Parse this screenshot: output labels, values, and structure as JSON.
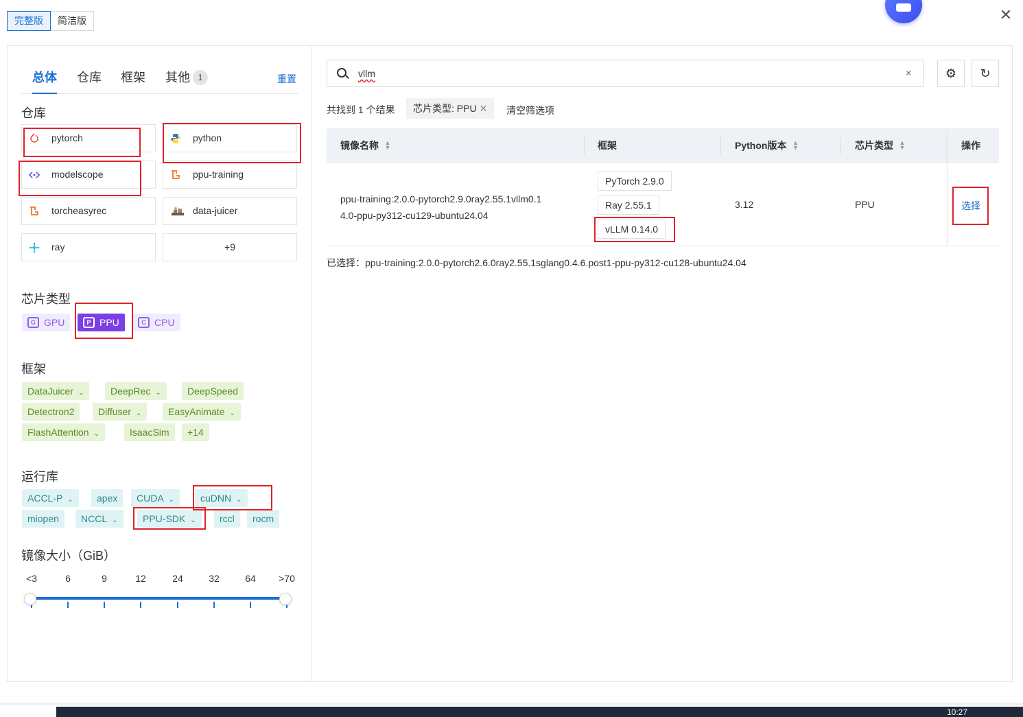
{
  "mode_switch": {
    "full": "完整版",
    "simple": "简洁版"
  },
  "tabs": [
    {
      "label": "总体"
    },
    {
      "label": "仓库"
    },
    {
      "label": "框架"
    },
    {
      "label": "其他",
      "badge": "1"
    }
  ],
  "reset_label": "重置",
  "sections": {
    "repo": "仓库",
    "chip": "芯片类型",
    "framework": "框架",
    "runtime": "运行库",
    "size": "镜像大小（GiB）"
  },
  "repos": [
    {
      "label": "pytorch",
      "icon": "pytorch-icon"
    },
    {
      "label": "python",
      "icon": "python-icon"
    },
    {
      "label": "modelscope",
      "icon": "modelscope-icon"
    },
    {
      "label": "ppu-training",
      "icon": "ppu-training-icon"
    },
    {
      "label": "torcheasyrec",
      "icon": "torcheasyrec-icon"
    },
    {
      "label": "data-juicer",
      "icon": "data-juicer-icon"
    },
    {
      "label": "ray",
      "icon": "ray-icon"
    },
    {
      "label": "+9"
    }
  ],
  "chips": [
    {
      "label": "GPU",
      "letter": "G"
    },
    {
      "label": "PPU",
      "letter": "P",
      "selected": true
    },
    {
      "label": "CPU",
      "letter": "C"
    }
  ],
  "frameworks": [
    "DataJuicer",
    "DeepRec",
    "DeepSpeed",
    "Detectron2",
    "Diffuser",
    "EasyAnimate",
    "FlashAttention",
    "IsaacSim",
    "+14"
  ],
  "runtimes": [
    "ACCL-P",
    "apex",
    "CUDA",
    "cuDNN",
    "miopen",
    "NCCL",
    "PPU-SDK",
    "rccl",
    "rocm"
  ],
  "size_marks": [
    "<3",
    "6",
    "9",
    "12",
    "24",
    "32",
    "64",
    ">70"
  ],
  "search": {
    "value": "vllm",
    "clear": "×"
  },
  "results": {
    "count_text": "共找到 1 个结果",
    "filter_tag": "芯片类型: PPU",
    "clear_filters": "清空筛选项"
  },
  "table": {
    "headers": {
      "name": "镜像名称",
      "framework": "框架",
      "python": "Python版本",
      "chip": "芯片类型",
      "op": "操作"
    },
    "rows": [
      {
        "name_line1": "ppu-training:2.0.0-pytorch2.9.0ray2.55.1vllm0.1",
        "name_line2": "4.0-ppu-py312-cu129-ubuntu24.04",
        "frameworks": [
          "PyTorch 2.9.0",
          "Ray 2.55.1",
          "vLLM 0.14.0"
        ],
        "python": "3.12",
        "chip": "PPU",
        "action": "选择"
      }
    ]
  },
  "selected_text": "已选择：ppu-training:2.0.0-pytorch2.6.0ray2.55.1sglang0.4.6.post1-ppu-py312-cu128-ubuntu24.04",
  "clock": "10:27",
  "colors": {
    "accent": "#1a70d6",
    "chip_selected": "#7b3fe4",
    "highlight_box": "#e0222a"
  }
}
